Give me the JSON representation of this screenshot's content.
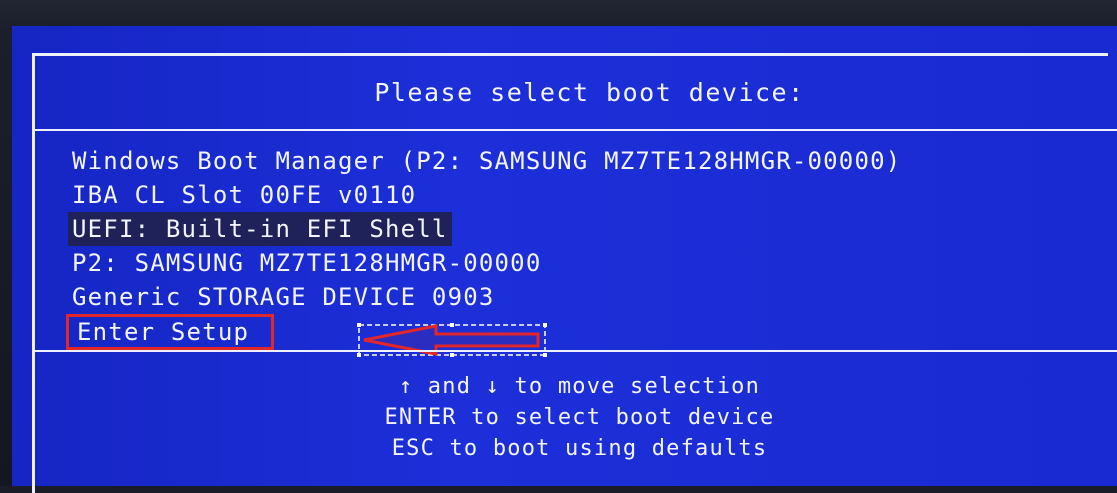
{
  "boot_menu": {
    "title": "Please select boot device:",
    "devices": [
      "Windows Boot Manager (P2: SAMSUNG MZ7TE128HMGR-00000)",
      "IBA CL Slot 00FE v0110",
      "UEFI: Built-in EFI Shell",
      "P2: SAMSUNG MZ7TE128HMGR-00000",
      "Generic STORAGE DEVICE 0903",
      "Enter Setup"
    ],
    "selected_index": 2,
    "highlighted_item": "Enter Setup",
    "instructions": [
      "↑ and ↓ to move selection",
      "ENTER to select boot device",
      "ESC to boot using defaults"
    ]
  },
  "colors": {
    "background": "#1a2ad0",
    "text": "#f2f4ff",
    "selection": "#1e2258",
    "annotation": "#e2262a"
  },
  "annotation": {
    "type": "arrow-left",
    "target": "Enter Setup"
  }
}
